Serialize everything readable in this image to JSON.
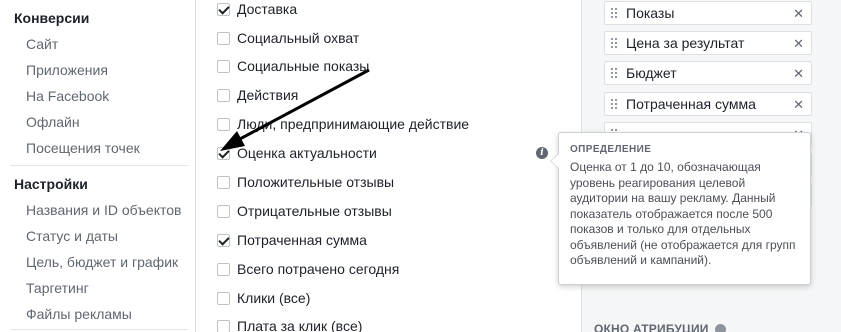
{
  "sidebar": {
    "section_conversions": "Конверсии",
    "conversion_items": [
      "Сайт",
      "Приложения",
      "На Facebook",
      "Офлайн",
      "Посещения точек"
    ],
    "section_settings": "Настройки",
    "settings_items": [
      "Названия и ID объектов",
      "Статус и даты",
      "Цель, бюджет и график",
      "Таргетинг",
      "Файлы рекламы"
    ]
  },
  "metrics": [
    {
      "label": "Доставка",
      "checked": true
    },
    {
      "label": "Социальный охват",
      "checked": false
    },
    {
      "label": "Социальные показы",
      "checked": false
    },
    {
      "label": "Действия",
      "checked": false
    },
    {
      "label": "Люди, предпринимающие действие",
      "checked": false
    },
    {
      "label": "Оценка актуальности",
      "checked": true
    },
    {
      "label": "Положительные отзывы",
      "checked": false
    },
    {
      "label": "Отрицательные отзывы",
      "checked": false
    },
    {
      "label": "Потраченная сумма",
      "checked": true
    },
    {
      "label": "Всего потрачено сегодня",
      "checked": false
    },
    {
      "label": "Клики (все)",
      "checked": false
    },
    {
      "label": "Плата за клик (все)",
      "checked": false
    }
  ],
  "selected_columns": [
    {
      "label": "Показы"
    },
    {
      "label": "Цена за результат"
    },
    {
      "label": "Бюджет"
    },
    {
      "label": "Потраченная сумма"
    },
    {
      "label": ""
    },
    {
      "label": ""
    },
    {
      "label": ""
    }
  ],
  "attribution_label": "ОКНО АТРИБУЦИИ",
  "tooltip": {
    "title": "ОПРЕДЕЛЕНИЕ",
    "body": "Оценка от 1 до 10, обозначающая уровень реагирования целевой аудитории на вашу рекламу. Данный показатель отображается после 500 показов и только для отдельных объявлений (не отображается для групп объявлений и кампаний)."
  },
  "icons": {
    "info": "info-icon",
    "remove": "close-icon",
    "drag": "drag-handle-icon",
    "annotation": "arrow-annotation"
  },
  "colors": {
    "annotation_arrow": "#000000",
    "panel_background": "#f5f6f7",
    "muted_text": "#606770"
  }
}
